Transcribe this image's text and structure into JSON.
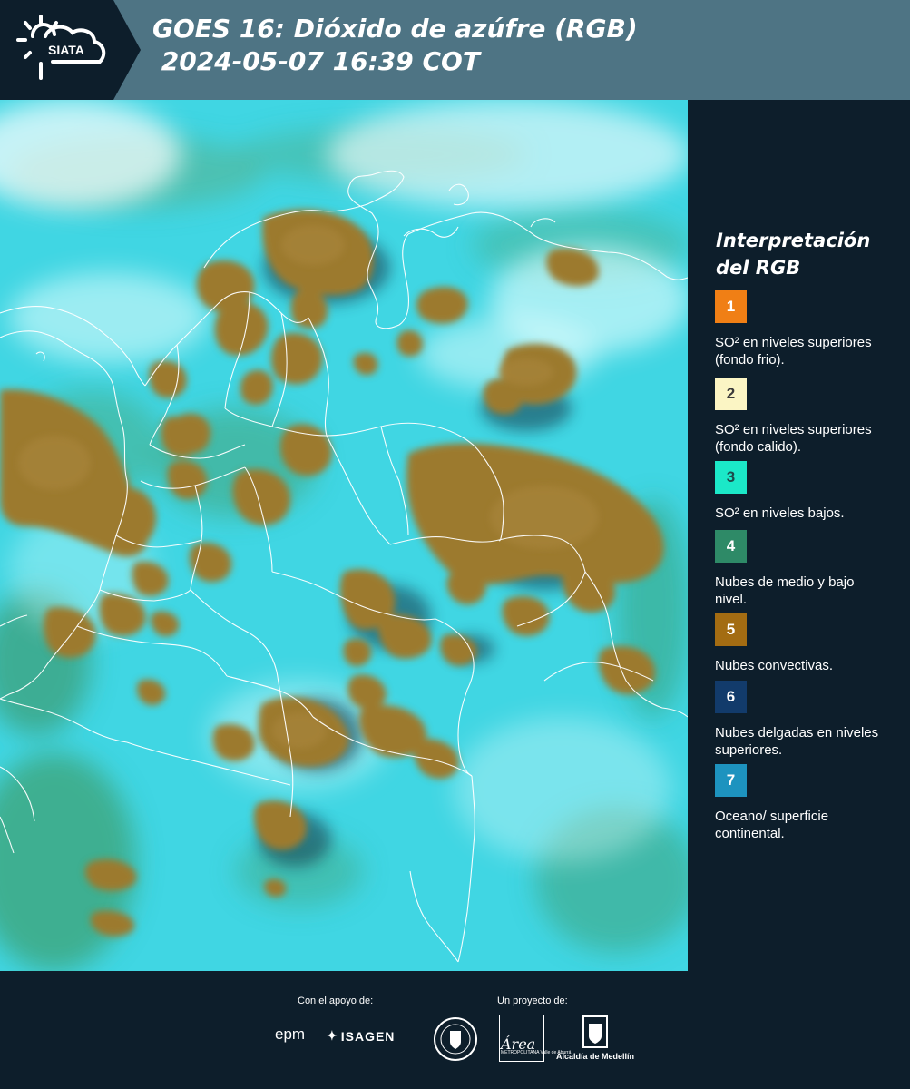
{
  "header": {
    "logo_text": "SIATA",
    "title_line1": "GOES 16: Dióxido de azúfre (RGB)",
    "title_line2": " 2024-05-07 16:39 COT",
    "background_color": "#4e7484",
    "logo_panel_color": "#0d1e2b"
  },
  "map": {
    "background_color": "#3fd8e4",
    "cloud_color": "#9b7a2c",
    "boundary_color": "#ffffff"
  },
  "legend": {
    "title": "Interpretación del RGB",
    "items": [
      {
        "number": "1",
        "color": "#f07f15",
        "text": "SO² en niveles superiores (fondo frio)."
      },
      {
        "number": "2",
        "color": "#fbf5c4",
        "text": "SO² en niveles superiores (fondo calido)."
      },
      {
        "number": "3",
        "color": "#1be8c8",
        "text": "SO² en niveles bajos."
      },
      {
        "number": "4",
        "color": "#2e8a67",
        "text": "Nubes de medio y bajo nivel."
      },
      {
        "number": "5",
        "color": "#a36c12",
        "text": "Nubes convectivas."
      },
      {
        "number": "6",
        "color": "#123b6b",
        "text": "Nubes delgadas en niveles superiores."
      },
      {
        "number": "7",
        "color": "#1d93bf",
        "text": "Oceano/ superficie continental."
      }
    ]
  },
  "footer": {
    "support_label": "Con el apoyo de:",
    "project_label": "Un proyecto de:",
    "sponsors": [
      "epm",
      "ISAGEN"
    ],
    "area_logo_text": "Área",
    "area_logo_subtext": "METROPOLITANA Valle de Aburrá",
    "alcaldia_label": "Alcaldía de Medellín"
  }
}
